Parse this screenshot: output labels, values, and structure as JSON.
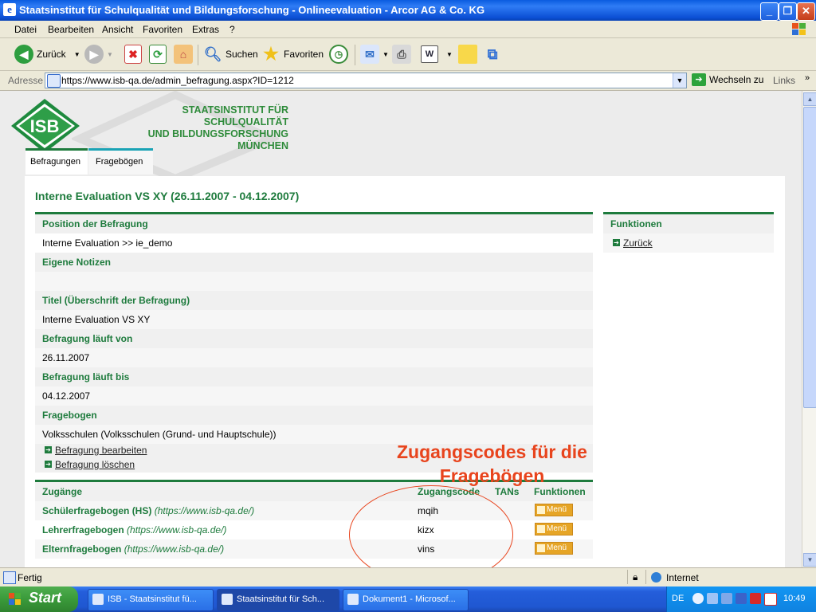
{
  "window": {
    "title": "Staatsinstitut für Schulqualität und Bildungsforschung - Onlineevaluation - Arcor AG & Co. KG"
  },
  "menu": [
    "Datei",
    "Bearbeiten",
    "Ansicht",
    "Favoriten",
    "Extras",
    "?"
  ],
  "toolbar": {
    "back": "Zurück",
    "search": "Suchen",
    "favorites": "Favoriten"
  },
  "address": {
    "label": "Adresse",
    "url": "https://www.isb-qa.de/admin_befragung.aspx?ID=1212",
    "go": "Wechseln zu",
    "links": "Links"
  },
  "site": {
    "institute": [
      "STAATSINSTITUT FÜR SCHULQUALITÄT",
      "UND BILDUNGSFORSCHUNG",
      "MÜNCHEN"
    ],
    "logo_text": "ISB",
    "tabs": [
      "Befragungen",
      "Fragebögen"
    ]
  },
  "page": {
    "heading": "Interne Evaluation VS XY (26.11.2007 - 04.12.2007)",
    "position_label": "Position der Befragung",
    "position_value": "Interne Evaluation  >>  ie_demo",
    "notes_label": "Eigene Notizen",
    "notes_value": "",
    "title_label": "Titel (Überschrift der Befragung)",
    "title_value": "Interne Evaluation VS XY",
    "from_label": "Befragung läuft von",
    "from_value": "26.11.2007",
    "until_label": "Befragung läuft bis",
    "until_value": "04.12.2007",
    "form_label": "Fragebogen",
    "form_value": "Volksschulen (Volksschulen (Grund- und Hauptschule))",
    "edit_link": "Befragung bearbeiten",
    "delete_link": "Befragung löschen"
  },
  "functions": {
    "label": "Funktionen",
    "back_link": "Zurück"
  },
  "access": {
    "headers": [
      "Zugänge",
      "Zugangscode",
      "TANs",
      "Funktionen"
    ],
    "rows": [
      {
        "name": "Schülerfragebogen (HS)",
        "url": "(https://www.isb-qa.de/)",
        "code": "mqih",
        "menu": "Menü"
      },
      {
        "name": "Lehrerfragebogen",
        "url": "(https://www.isb-qa.de/)",
        "code": "kizx",
        "menu": "Menü"
      },
      {
        "name": "Elternfragebogen",
        "url": "(https://www.isb-qa.de/)",
        "code": "vins",
        "menu": "Menü"
      }
    ]
  },
  "annotation": {
    "line1": "Zugangscodes  für die",
    "line2": "Fragebögen",
    "color": "#e8441d"
  },
  "status": {
    "left": "Fertig",
    "zone": "Internet"
  },
  "taskbar": {
    "start": "Start",
    "tasks": [
      "ISB - Staatsinstitut fü...",
      "Staatsinstitut für Sch...",
      "Dokument1 - Microsof..."
    ],
    "lang": "DE",
    "clock": "10:49"
  },
  "colors": {
    "brand_green": "#1e7b3d",
    "title_blue": "#0a5be0"
  }
}
